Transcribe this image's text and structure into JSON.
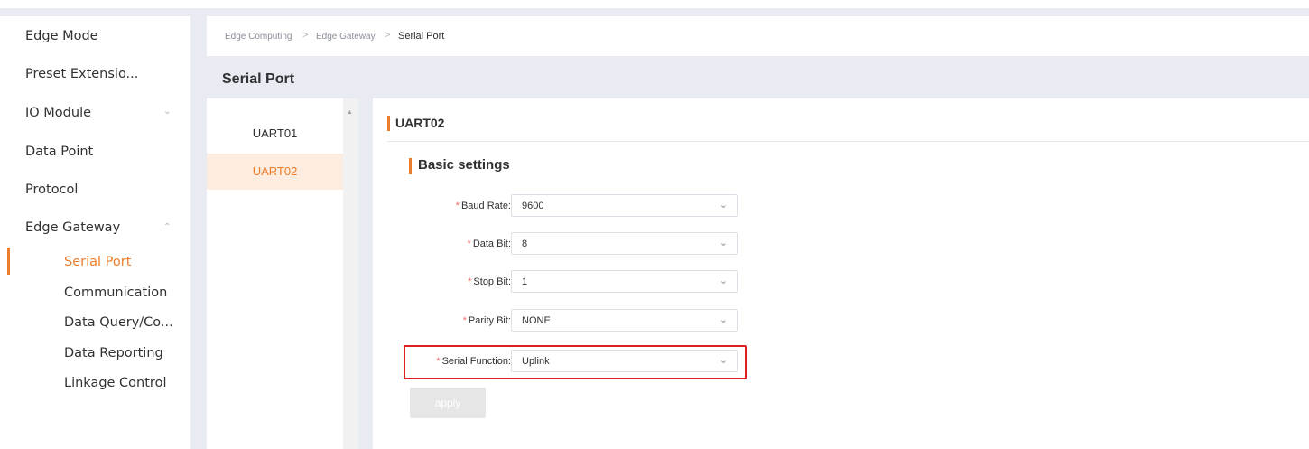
{
  "sidebar": {
    "items": [
      {
        "label": "Edge Mode"
      },
      {
        "label": "Preset Extensio..."
      },
      {
        "label": "IO Module",
        "chevron": "chevron-down-icon"
      },
      {
        "label": "Data Point"
      },
      {
        "label": "Protocol"
      },
      {
        "label": "Edge Gateway",
        "chevron": "chevron-up-icon"
      }
    ],
    "sub_items": [
      {
        "label": "Serial Port",
        "active": true
      },
      {
        "label": "Communication"
      },
      {
        "label": "Data Query/Co..."
      },
      {
        "label": "Data Reporting"
      },
      {
        "label": "Linkage Control"
      }
    ]
  },
  "breadcrumb": {
    "items": [
      "Edge Computing",
      "Edge Gateway",
      "Serial Port"
    ],
    "separator": ">"
  },
  "page": {
    "title": "Serial Port"
  },
  "uart_list": {
    "items": [
      {
        "label": "UART01"
      },
      {
        "label": "UART02",
        "selected": true
      }
    ]
  },
  "detail": {
    "section_title": "UART02",
    "subsection_title": "Basic settings",
    "fields": {
      "baud_rate": {
        "label": "Baud Rate:",
        "value": "9600"
      },
      "data_bit": {
        "label": "Data Bit:",
        "value": "8"
      },
      "stop_bit": {
        "label": "Stop Bit:",
        "value": "1"
      },
      "parity_bit": {
        "label": "Parity Bit:",
        "value": "NONE"
      },
      "serial_function": {
        "label": "Serial Function:",
        "value": "Uplink"
      }
    },
    "required_mark": "*",
    "apply_label": "apply"
  },
  "colors": {
    "accent": "#ec7d2c",
    "highlight_border": "#e02020",
    "required": "#f56c6c"
  }
}
